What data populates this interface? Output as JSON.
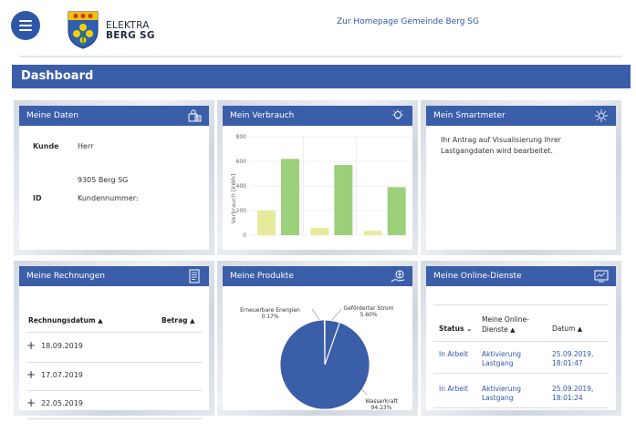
{
  "header": {
    "brand_line1": "ELEKTRA",
    "brand_line2": "BERG SG",
    "homepage_link": "Zur Homepage Gemeinde Berg SG"
  },
  "dashboard_title": "Dashboard",
  "meine_daten": {
    "title": "Meine Daten",
    "kunde_label": "Kunde",
    "kunde_value": "Herr",
    "address": "9305 Berg SG",
    "id_label": "ID",
    "id_value": "Kundennummer:"
  },
  "verbrauch": {
    "title": "Mein Verbrauch"
  },
  "chart_data": {
    "type": "bar",
    "ylabel": "Verbrauch [kWh]",
    "ylim": [
      0,
      800
    ],
    "yticks": [
      "800",
      "600",
      "400",
      "200",
      "0"
    ],
    "categories": [
      "",
      "",
      ""
    ],
    "series": [
      {
        "name": "",
        "color": "#e6eb9c",
        "values": [
          200,
          60,
          35
        ]
      },
      {
        "name": "",
        "color": "#9cd07a",
        "values": [
          620,
          570,
          390
        ]
      }
    ]
  },
  "smartmeter": {
    "title": "Mein Smartmeter",
    "text": "Ihr Antrag auf Visualisierung Ihrer Lastgangdaten wird bearbeitet."
  },
  "rechnungen": {
    "title": "Meine Rechnungen",
    "col_date": "Rechnungsdatum",
    "col_amount": "Betrag",
    "items": [
      "18.09.2019",
      "17.07.2019",
      "22.05.2019"
    ]
  },
  "produkte": {
    "title": "Meine Produkte",
    "label_erneuerbar": "Erneuerbare Energien",
    "pct_erneuerbar": "0.17%",
    "label_gefoerdert": "Geförderter Strom",
    "pct_gefoerdert": "5.60%",
    "label_wasser": "Wasserkraft",
    "pct_wasser": "94.23%",
    "pie_color": "#3b5ea9"
  },
  "online_dienste": {
    "title": "Meine Online-Dienste",
    "col_status": "Status",
    "col_dienste_1": "Meine Online-",
    "col_dienste_2": "Dienste",
    "col_datum": "Datum",
    "rows": [
      {
        "status": "In Arbeit",
        "service1": "Aktivierung",
        "service2": "Lastgang",
        "date1": "25.09.2019,",
        "date2": "18:01:47"
      },
      {
        "status": "In Arbeit",
        "service1": "Aktivierung",
        "service2": "Lastgang",
        "date1": "25.09.2019,",
        "date2": "18:01:24"
      }
    ]
  },
  "colors": {
    "brand_blue": "#3b5ea9",
    "link_blue": "#2f57a8"
  }
}
